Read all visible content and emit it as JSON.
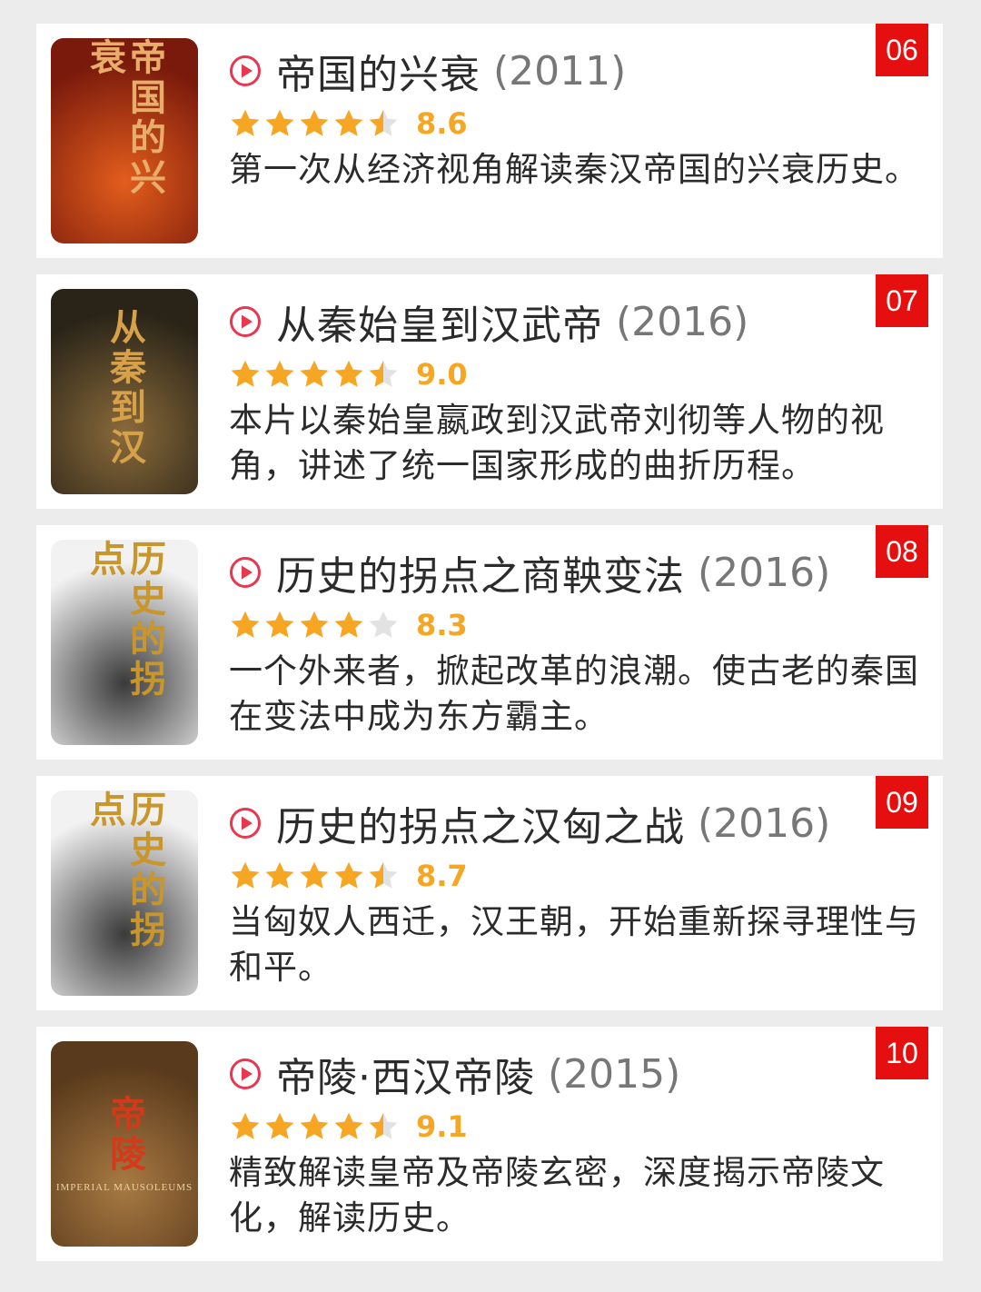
{
  "items": [
    {
      "rank": "06",
      "title": "帝国的兴衰",
      "year": "(2011)",
      "stars": 4.5,
      "score": "8.6",
      "description": "第一次从经济视角解读秦汉帝国的兴衰历史。",
      "poster": {
        "text": "帝国的兴衰",
        "sub": "",
        "bg": "#7a1a0c",
        "fg": "#e8ad6a",
        "accent": "#e35d1c"
      }
    },
    {
      "rank": "07",
      "title": "从秦始皇到汉武帝",
      "year": "(2016)",
      "stars": 4.5,
      "score": "9.0",
      "description": "本片以秦始皇嬴政到汉武帝刘彻等人物的视角，讲述了统一国家形成的曲折历程。",
      "poster": {
        "text": "从秦到汉",
        "sub": "",
        "bg": "#2a2418",
        "fg": "#d7a14a",
        "accent": "#8a6a3a"
      }
    },
    {
      "rank": "08",
      "title": "历史的拐点之商鞅变法",
      "year": "(2016)",
      "stars": 4,
      "score": "8.3",
      "description": "一个外来者，掀起改革的浪潮。使古老的秦国在变法中成为东方霸主。",
      "poster": {
        "text": "历史的拐点",
        "sub": "",
        "bg": "#f2f2f2",
        "fg": "#c8962a",
        "accent": "#3a3a3a"
      }
    },
    {
      "rank": "09",
      "title": "历史的拐点之汉匈之战",
      "year": "(2016)",
      "stars": 4.5,
      "score": "8.7",
      "description": "当匈奴人西迁，汉王朝，开始重新探寻理性与和平。",
      "poster": {
        "text": "历史的拐点",
        "sub": "",
        "bg": "#f2f2f2",
        "fg": "#c8962a",
        "accent": "#3a3a3a"
      }
    },
    {
      "rank": "10",
      "title": "帝陵·西汉帝陵",
      "year": "(2015)",
      "stars": 4.5,
      "score": "9.1",
      "description": "精致解读皇帝及帝陵玄密，深度揭示帝陵文化，解读历史。",
      "poster": {
        "text": "帝陵",
        "sub": "IMPERIAL MAUSOLEUMS",
        "bg": "#5a3a1c",
        "fg": "#d33a1a",
        "accent": "#a87a42"
      }
    }
  ],
  "colors": {
    "accent_red": "#e60f0f",
    "star": "#f6a623",
    "star_empty": "#e2e2e2",
    "play": "#e8384f"
  },
  "icons": {
    "play": "play-circle-icon",
    "star": "star-icon"
  }
}
